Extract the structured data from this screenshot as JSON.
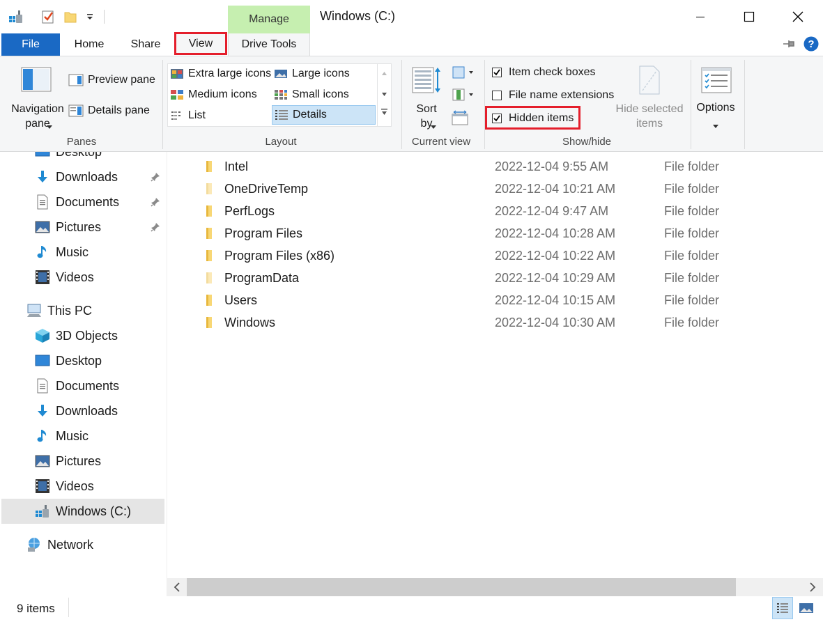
{
  "window": {
    "title": "Windows (C:)",
    "context_tab": "Manage"
  },
  "tabs": [
    {
      "label": "File"
    },
    {
      "label": "Home"
    },
    {
      "label": "Share"
    },
    {
      "label": "View"
    },
    {
      "label": "Drive Tools"
    }
  ],
  "ribbon": {
    "panes": {
      "navigation_pane_label": "Navigation pane",
      "preview_pane": "Preview pane",
      "details_pane": "Details pane",
      "group_label": "Panes"
    },
    "layout": {
      "items": [
        "Extra large icons",
        "Large icons",
        "Medium icons",
        "Small icons",
        "List",
        "Details"
      ],
      "selected": "Details",
      "group_label": "Layout"
    },
    "current_view": {
      "sort_by_label": "Sort by",
      "group_label": "Current view"
    },
    "show_hide": {
      "item_check_boxes": {
        "label": "Item check boxes",
        "checked": true
      },
      "file_name_extensions": {
        "label": "File name extensions",
        "checked": false
      },
      "hidden_items": {
        "label": "Hidden items",
        "checked": true
      },
      "hide_selected_items": "Hide selected items",
      "group_label": "Show/hide"
    },
    "options_label": "Options"
  },
  "nav": {
    "quick_access": [
      {
        "label": "Desktop",
        "icon": "desktop-icon",
        "pinned": false
      },
      {
        "label": "Downloads",
        "icon": "downloads-icon",
        "pinned": true
      },
      {
        "label": "Documents",
        "icon": "documents-icon",
        "pinned": true
      },
      {
        "label": "Pictures",
        "icon": "pictures-icon",
        "pinned": true
      },
      {
        "label": "Music",
        "icon": "music-icon",
        "pinned": false
      },
      {
        "label": "Videos",
        "icon": "videos-icon",
        "pinned": false
      }
    ],
    "this_pc": "This PC",
    "this_pc_items": [
      {
        "label": "3D Objects",
        "icon": "3d-objects-icon"
      },
      {
        "label": "Desktop",
        "icon": "desktop-icon"
      },
      {
        "label": "Documents",
        "icon": "documents-icon"
      },
      {
        "label": "Downloads",
        "icon": "downloads-icon"
      },
      {
        "label": "Music",
        "icon": "music-icon"
      },
      {
        "label": "Pictures",
        "icon": "pictures-icon"
      },
      {
        "label": "Videos",
        "icon": "videos-icon"
      },
      {
        "label": "Windows (C:)",
        "icon": "drive-icon",
        "selected": true
      }
    ],
    "network": "Network"
  },
  "files": [
    {
      "name": "Intel",
      "date": "2022-12-04 9:55 AM",
      "type": "File folder",
      "hidden": false
    },
    {
      "name": "OneDriveTemp",
      "date": "2022-12-04 10:21 AM",
      "type": "File folder",
      "hidden": true
    },
    {
      "name": "PerfLogs",
      "date": "2022-12-04 9:47 AM",
      "type": "File folder",
      "hidden": false
    },
    {
      "name": "Program Files",
      "date": "2022-12-04 10:28 AM",
      "type": "File folder",
      "hidden": false
    },
    {
      "name": "Program Files (x86)",
      "date": "2022-12-04 10:22 AM",
      "type": "File folder",
      "hidden": false
    },
    {
      "name": "ProgramData",
      "date": "2022-12-04 10:29 AM",
      "type": "File folder",
      "hidden": true
    },
    {
      "name": "Users",
      "date": "2022-12-04 10:15 AM",
      "type": "File folder",
      "hidden": false
    },
    {
      "name": "Windows",
      "date": "2022-12-04 10:30 AM",
      "type": "File folder",
      "hidden": false
    }
  ],
  "status": {
    "item_count": "9 items"
  },
  "colors": {
    "file_tab": "#1a69c4",
    "manage_tab": "#c6efb0",
    "highlight": "#e41e2b",
    "folder": "#f8d775",
    "folder_hidden": "#fbe9b8",
    "selection": "#cce4f7"
  }
}
